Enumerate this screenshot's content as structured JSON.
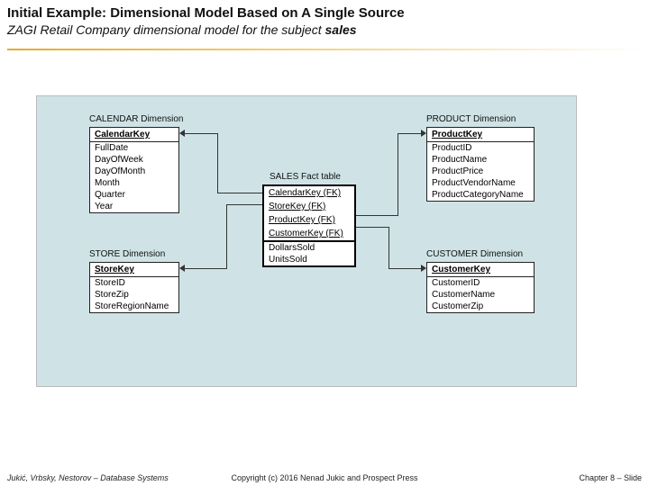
{
  "header": {
    "title": "Initial Example: Dimensional Model Based on A Single Source",
    "subtitle_prefix": "ZAGI Retail Company dimensional model for the subject ",
    "subtitle_bold": "sales"
  },
  "tables": {
    "calendar": {
      "title": "CALENDAR Dimension",
      "pk": "CalendarKey",
      "rows": [
        "FullDate",
        "DayOfWeek",
        "DayOfMonth",
        "Month",
        "Quarter",
        "Year"
      ]
    },
    "store": {
      "title": "STORE Dimension",
      "pk": "StoreKey",
      "rows": [
        "StoreID",
        "StoreZip",
        "StoreRegionName"
      ]
    },
    "product": {
      "title": "PRODUCT Dimension",
      "pk": "ProductKey",
      "rows": [
        "ProductID",
        "ProductName",
        "ProductPrice",
        "ProductVendorName",
        "ProductCategoryName"
      ]
    },
    "customer": {
      "title": "CUSTOMER Dimension",
      "pk": "CustomerKey",
      "rows": [
        "CustomerID",
        "CustomerName",
        "CustomerZip"
      ]
    },
    "fact": {
      "title": "SALES Fact table",
      "pks": [
        "CalendarKey (FK)",
        "StoreKey (FK)",
        "ProductKey (FK)",
        "CustomerKey (FK)"
      ],
      "rows": [
        "DollarsSold",
        "UnitsSold"
      ]
    }
  },
  "footer": {
    "left": "Jukić, Vrbsky, Nestorov – Database Systems",
    "center": "Copyright (c) 2016 Nenad Jukic and Prospect Press",
    "right": "Chapter 8 – Slide"
  }
}
